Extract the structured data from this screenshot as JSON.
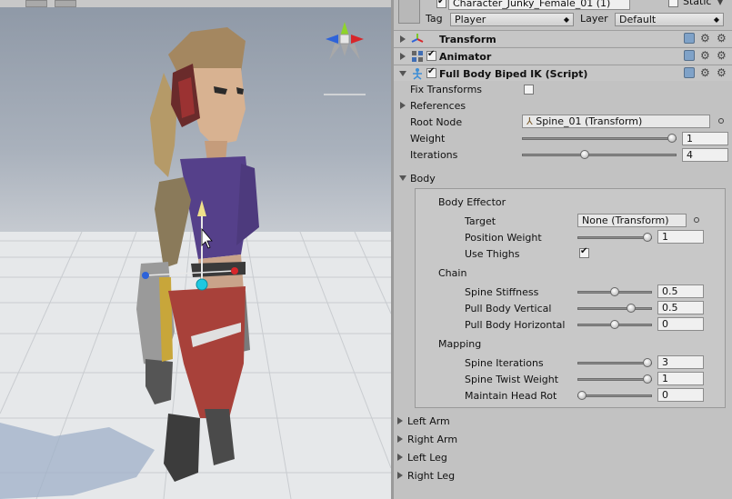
{
  "header": {
    "object_name": "Character_Junky_Female_01 (1)",
    "static_label": "Static",
    "tag_label": "Tag",
    "tag_value": "Player",
    "layer_label": "Layer",
    "layer_value": "Default"
  },
  "components": {
    "transform": "Transform",
    "animator": "Animator",
    "fbbik": "Full Body Biped IK (Script)"
  },
  "fbbik": {
    "fix_transforms_label": "Fix Transforms",
    "references_label": "References",
    "root_node_label": "Root Node",
    "root_node_value": "Spine_01 (Transform)",
    "weight_label": "Weight",
    "weight_value": "1",
    "weight_level": 1.0,
    "iterations_label": "Iterations",
    "iterations_value": "4",
    "iterations_level": 0.4
  },
  "body": {
    "label": "Body",
    "effector_label": "Body Effector",
    "target_label": "Target",
    "target_value": "None (Transform)",
    "position_weight_label": "Position Weight",
    "position_weight_value": "1",
    "position_weight_level": 1.0,
    "use_thighs_label": "Use Thighs",
    "chain_label": "Chain",
    "spine_stiffness_label": "Spine Stiffness",
    "spine_stiffness_value": "0.5",
    "spine_stiffness_level": 0.5,
    "pull_vertical_label": "Pull Body Vertical",
    "pull_vertical_value": "0.5",
    "pull_vertical_level": 0.75,
    "pull_horizontal_label": "Pull Body Horizontal",
    "pull_horizontal_value": "0",
    "pull_horizontal_level": 0.5,
    "mapping_label": "Mapping",
    "spine_iterations_label": "Spine Iterations",
    "spine_iterations_value": "3",
    "spine_iterations_level": 1.0,
    "spine_twist_label": "Spine Twist Weight",
    "spine_twist_value": "1",
    "spine_twist_level": 1.0,
    "head_rot_label": "Maintain Head Rot",
    "head_rot_value": "0",
    "head_rot_level": 0.0
  },
  "limbs": {
    "left_arm": "Left Arm",
    "right_arm": "Right Arm",
    "left_leg": "Left Leg",
    "right_leg": "Right Leg"
  },
  "colors": {
    "panel": "#c2c2c2",
    "field": "#f0f0f0",
    "axis_x": "#d7262a",
    "axis_y": "#8fd42a",
    "axis_z": "#2e63d9"
  }
}
